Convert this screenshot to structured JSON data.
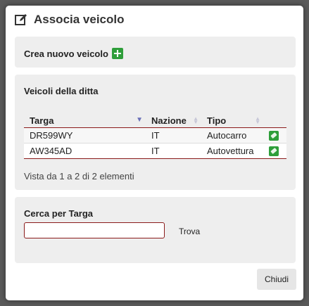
{
  "modal": {
    "title": "Associa veicolo",
    "title_icon": "edit-icon"
  },
  "crea": {
    "label": "Crea nuovo veicolo",
    "icon": "plus-icon"
  },
  "veicoli": {
    "title": "Veicoli della ditta",
    "columns": [
      "Targa",
      "Nazione",
      "Tipo"
    ],
    "rows": [
      {
        "targa": "DR599WY",
        "nazione": "IT",
        "tipo": "Autocarro"
      },
      {
        "targa": "AW345AD",
        "nazione": "IT",
        "tipo": "Autovettura"
      }
    ],
    "info": "Vista da 1 a 2 di 2 elementi"
  },
  "cerca": {
    "title": "Cerca per Targa",
    "input_value": "",
    "button": "Trova"
  },
  "footer": {
    "close": "Chiudi"
  },
  "colors": {
    "accent_green": "#2e9e3a",
    "border_red": "#8a1a1a",
    "panel_bg": "#eeeeee"
  }
}
